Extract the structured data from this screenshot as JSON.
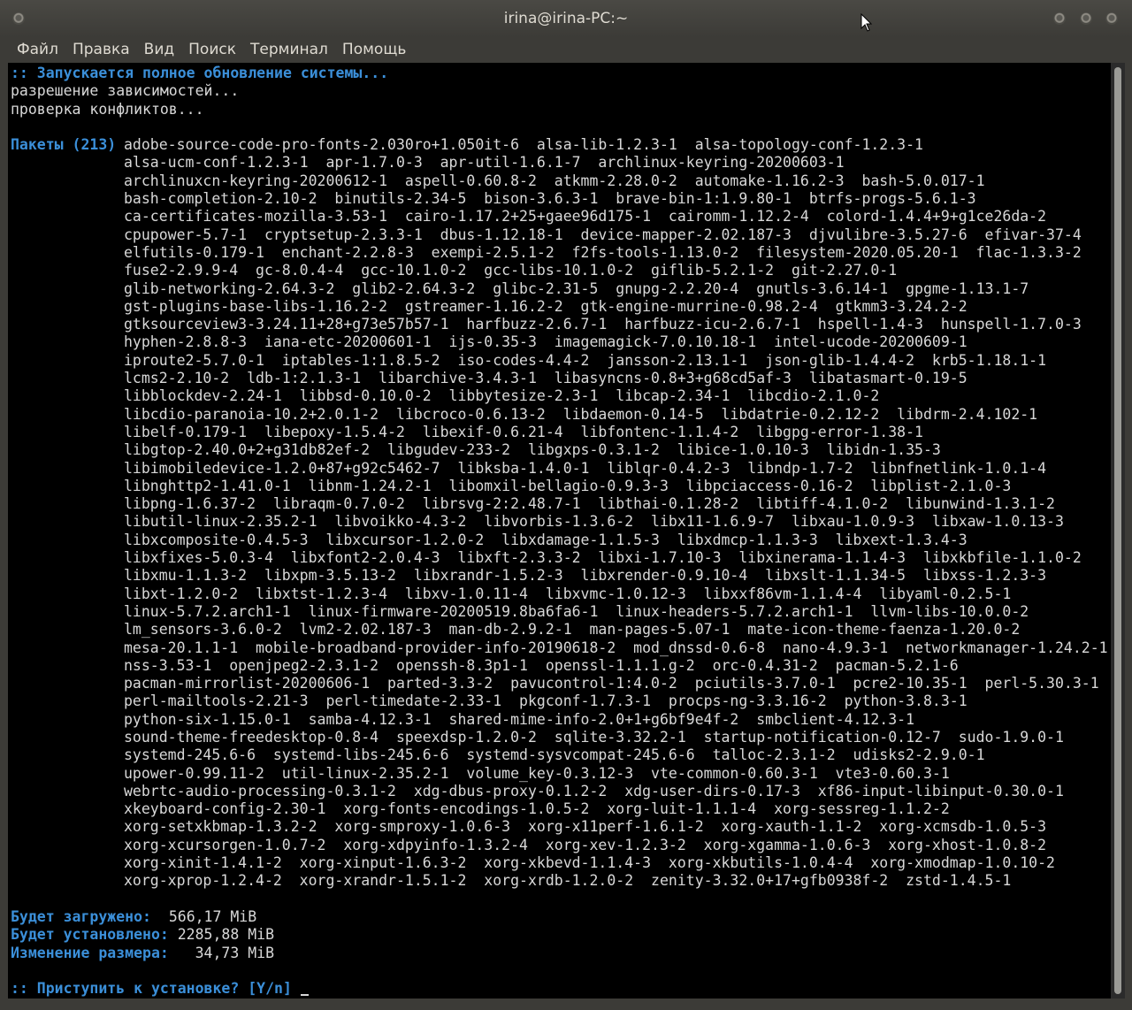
{
  "window": {
    "title": "irina@irina-PC:~"
  },
  "menu": [
    "Файл",
    "Правка",
    "Вид",
    "Поиск",
    "Терминал",
    "Помощь"
  ],
  "terminal": {
    "start_line": ":: Запускается полное обновление системы...",
    "line2": "разрешение зависимостей...",
    "line3": "проверка конфликтов...",
    "packages_label": "Пакеты (213)",
    "package_lines": [
      "adobe-source-code-pro-fonts-2.030ro+1.050it-6  alsa-lib-1.2.3-1  alsa-topology-conf-1.2.3-1",
      "alsa-ucm-conf-1.2.3-1  apr-1.7.0-3  apr-util-1.6.1-7  archlinux-keyring-20200603-1",
      "archlinuxcn-keyring-20200612-1  aspell-0.60.8-2  atkmm-2.28.0-2  automake-1.16.2-3  bash-5.0.017-1",
      "bash-completion-2.10-2  binutils-2.34-5  bison-3.6.3-1  brave-bin-1:1.9.80-1  btrfs-progs-5.6.1-3",
      "ca-certificates-mozilla-3.53-1  cairo-1.17.2+25+gaee96d175-1  cairomm-1.12.2-4  colord-1.4.4+9+g1ce26da-2",
      "cpupower-5.7-1  cryptsetup-2.3.3-1  dbus-1.12.18-1  device-mapper-2.02.187-3  djvulibre-3.5.27-6  efivar-37-4",
      "elfutils-0.179-1  enchant-2.2.8-3  exempi-2.5.1-2  f2fs-tools-1.13.0-2  filesystem-2020.05.20-1  flac-1.3.3-2",
      "fuse2-2.9.9-4  gc-8.0.4-4  gcc-10.1.0-2  gcc-libs-10.1.0-2  giflib-5.2.1-2  git-2.27.0-1",
      "glib-networking-2.64.3-2  glib2-2.64.3-2  glibc-2.31-5  gnupg-2.2.20-4  gnutls-3.6.14-1  gpgme-1.13.1-7",
      "gst-plugins-base-libs-1.16.2-2  gstreamer-1.16.2-2  gtk-engine-murrine-0.98.2-4  gtkmm3-3.24.2-2",
      "gtksourceview3-3.24.11+28+g73e57b57-1  harfbuzz-2.6.7-1  harfbuzz-icu-2.6.7-1  hspell-1.4-3  hunspell-1.7.0-3",
      "hyphen-2.8.8-3  iana-etc-20200601-1  ijs-0.35-3  imagemagick-7.0.10.18-1  intel-ucode-20200609-1",
      "iproute2-5.7.0-1  iptables-1:1.8.5-2  iso-codes-4.4-2  jansson-2.13.1-1  json-glib-1.4.4-2  krb5-1.18.1-1",
      "lcms2-2.10-2  ldb-1:2.1.3-1  libarchive-3.4.3-1  libasyncns-0.8+3+g68cd5af-3  libatasmart-0.19-5",
      "libblockdev-2.24-1  libbsd-0.10.0-2  libbytesize-2.3-1  libcap-2.34-1  libcdio-2.1.0-2",
      "libcdio-paranoia-10.2+2.0.1-2  libcroco-0.6.13-2  libdaemon-0.14-5  libdatrie-0.2.12-2  libdrm-2.4.102-1",
      "libelf-0.179-1  libepoxy-1.5.4-2  libexif-0.6.21-4  libfontenc-1.1.4-2  libgpg-error-1.38-1",
      "libgtop-2.40.0+2+g31db82ef-2  libgudev-233-2  libgxps-0.3.1-2  libice-1.0.10-3  libidn-1.35-3",
      "libimobiledevice-1.2.0+87+g92c5462-7  libksba-1.4.0-1  liblqr-0.4.2-3  libndp-1.7-2  libnfnetlink-1.0.1-4",
      "libnghttp2-1.41.0-1  libnm-1.24.2-1  libomxil-bellagio-0.9.3-3  libpciaccess-0.16-2  libplist-2.1.0-3",
      "libpng-1.6.37-2  libraqm-0.7.0-2  librsvg-2:2.48.7-1  libthai-0.1.28-2  libtiff-4.1.0-2  libunwind-1.3.1-2",
      "libutil-linux-2.35.2-1  libvoikko-4.3-2  libvorbis-1.3.6-2  libx11-1.6.9-7  libxau-1.0.9-3  libxaw-1.0.13-3",
      "libxcomposite-0.4.5-3  libxcursor-1.2.0-2  libxdamage-1.1.5-3  libxdmcp-1.1.3-3  libxext-1.3.4-3",
      "libxfixes-5.0.3-4  libxfont2-2.0.4-3  libxft-2.3.3-2  libxi-1.7.10-3  libxinerama-1.1.4-3  libxkbfile-1.1.0-2",
      "libxmu-1.1.3-2  libxpm-3.5.13-2  libxrandr-1.5.2-3  libxrender-0.9.10-4  libxslt-1.1.34-5  libxss-1.2.3-3",
      "libxt-1.2.0-2  libxtst-1.2.3-4  libxv-1.0.11-4  libxvmc-1.0.12-3  libxxf86vm-1.1.4-4  libyaml-0.2.5-1",
      "linux-5.7.2.arch1-1  linux-firmware-20200519.8ba6fa6-1  linux-headers-5.7.2.arch1-1  llvm-libs-10.0.0-2",
      "lm_sensors-3.6.0-2  lvm2-2.02.187-3  man-db-2.9.2-1  man-pages-5.07-1  mate-icon-theme-faenza-1.20.0-2",
      "mesa-20.1.1-1  mobile-broadband-provider-info-20190618-2  mod_dnssd-0.6-8  nano-4.9.3-1  networkmanager-1.24.2-1",
      "nss-3.53-1  openjpeg2-2.3.1-2  openssh-8.3p1-1  openssl-1.1.1.g-2  orc-0.4.31-2  pacman-5.2.1-6",
      "pacman-mirrorlist-20200606-1  parted-3.3-2  pavucontrol-1:4.0-2  pciutils-3.7.0-1  pcre2-10.35-1  perl-5.30.3-1",
      "perl-mailtools-2.21-3  perl-timedate-2.33-1  pkgconf-1.7.3-1  procps-ng-3.3.16-2  python-3.8.3-1",
      "python-six-1.15.0-1  samba-4.12.3-1  shared-mime-info-2.0+1+g6bf9e4f-2  smbclient-4.12.3-1",
      "sound-theme-freedesktop-0.8-4  speexdsp-1.2.0-2  sqlite-3.32.2-1  startup-notification-0.12-7  sudo-1.9.0-1",
      "systemd-245.6-6  systemd-libs-245.6-6  systemd-sysvcompat-245.6-6  talloc-2.3.1-2  udisks2-2.9.0-1",
      "upower-0.99.11-2  util-linux-2.35.2-1  volume_key-0.3.12-3  vte-common-0.60.3-1  vte3-0.60.3-1",
      "webrtc-audio-processing-0.3.1-2  xdg-dbus-proxy-0.1.2-2  xdg-user-dirs-0.17-3  xf86-input-libinput-0.30.0-1",
      "xkeyboard-config-2.30-1  xorg-fonts-encodings-1.0.5-2  xorg-luit-1.1.1-4  xorg-sessreg-1.1.2-2",
      "xorg-setxkbmap-1.3.2-2  xorg-smproxy-1.0.6-3  xorg-x11perf-1.6.1-2  xorg-xauth-1.1-2  xorg-xcmsdb-1.0.5-3",
      "xorg-xcursorgen-1.0.7-2  xorg-xdpyinfo-1.3.2-4  xorg-xev-1.2.3-2  xorg-xgamma-1.0.6-3  xorg-xhost-1.0.8-2",
      "xorg-xinit-1.4.1-2  xorg-xinput-1.6.3-2  xorg-xkbevd-1.1.4-3  xorg-xkbutils-1.0.4-4  xorg-xmodmap-1.0.10-2",
      "xorg-xprop-1.2.4-2  xorg-xrandr-1.5.1-2  xorg-xrdb-1.2.0-2  zenity-3.32.0+17+gfb0938f-2  zstd-1.4.5-1"
    ],
    "download_label": "Будет загружено:",
    "download_value": "  566,17 MiB",
    "install_label": "Будет установлено:",
    "install_value": " 2285,88 MiB",
    "change_label": "Изменение размера:",
    "change_value": "   34,73 MiB",
    "prompt": ":: Приступить к установке? [Y/n]"
  }
}
